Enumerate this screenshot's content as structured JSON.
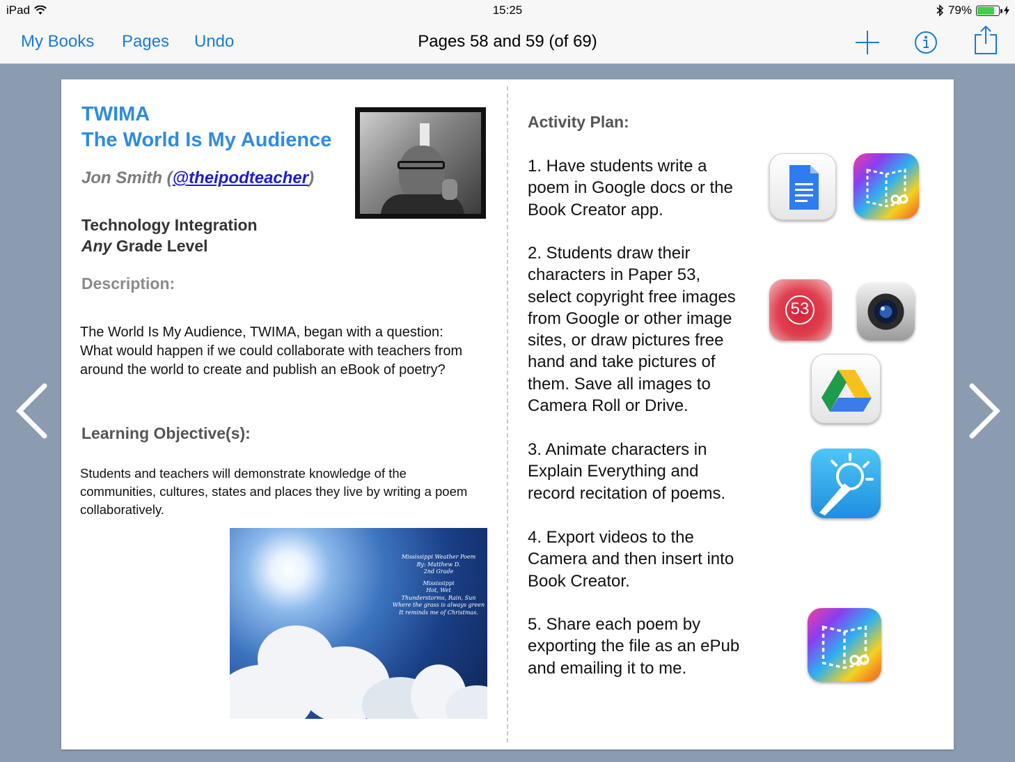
{
  "status_bar": {
    "device": "iPad",
    "time": "15:25",
    "battery": "79%",
    "battery_level": 0.79
  },
  "nav": {
    "my_books": "My Books",
    "pages": "Pages",
    "undo": "Undo",
    "title_main": "Pages 58 and 59",
    "title_suffix": " (of 69)"
  },
  "left_page": {
    "title_line1": "TWIMA",
    "title_line2": "The World Is My Audience",
    "author_name": "Jon Smith (",
    "author_handle": "@theipodteacher",
    "author_close": ")",
    "tech_line1": "Technology Integration",
    "tech_any": "Any",
    "tech_line2_rest": " Grade Level",
    "description_heading": "Description:",
    "description": "The World Is My Audience, TWIMA, began with a question: What would happen if we could collaborate with teachers from around the world to create and publish an eBook of poetry?",
    "objectives_heading": "Learning Objective(s):",
    "objectives": "Students and teachers will demonstrate knowledge of the communities, cultures, states and places they live by writing a poem collaboratively.",
    "poem_image": {
      "lines": [
        "Mississippi Weather Poem",
        "By: Matthew D.",
        "2nd Grade",
        "",
        "Mississippi",
        "Hot, Wet",
        "Thunderstorms, Rain, Sun",
        "Where the grass is always green",
        "It reminds me of Christmas."
      ]
    }
  },
  "right_page": {
    "activity_heading": "Activity Plan:",
    "steps": [
      [
        "1. Have students write a",
        "poem in Google docs or the",
        "Book Creator app."
      ],
      [
        "2. Students draw their",
        "characters in Paper 53,",
        "select copyright free images",
        "from Google or other image",
        "sites, or draw pictures free",
        "hand and take pictures of",
        "them. Save all images to",
        "Camera Roll or Drive."
      ],
      [
        "3. Animate characters in",
        "Explain Everything and",
        "record recitation of poems."
      ],
      [
        "4. Export videos to the",
        "Camera and then insert into",
        "Book Creator."
      ],
      [
        "5. Share each poem by",
        "exporting the file as an ePub",
        "and emailing it to me."
      ]
    ],
    "paper53_label": "53"
  },
  "colors": {
    "accent": "#1a7ad6",
    "title_blue": "#2f8be0",
    "background": "#8b9cb1"
  },
  "icons": [
    "wifi-icon",
    "bluetooth-icon",
    "battery-icon",
    "plus-icon",
    "info-icon",
    "share-icon",
    "chevron-left-icon",
    "chevron-right-icon"
  ]
}
